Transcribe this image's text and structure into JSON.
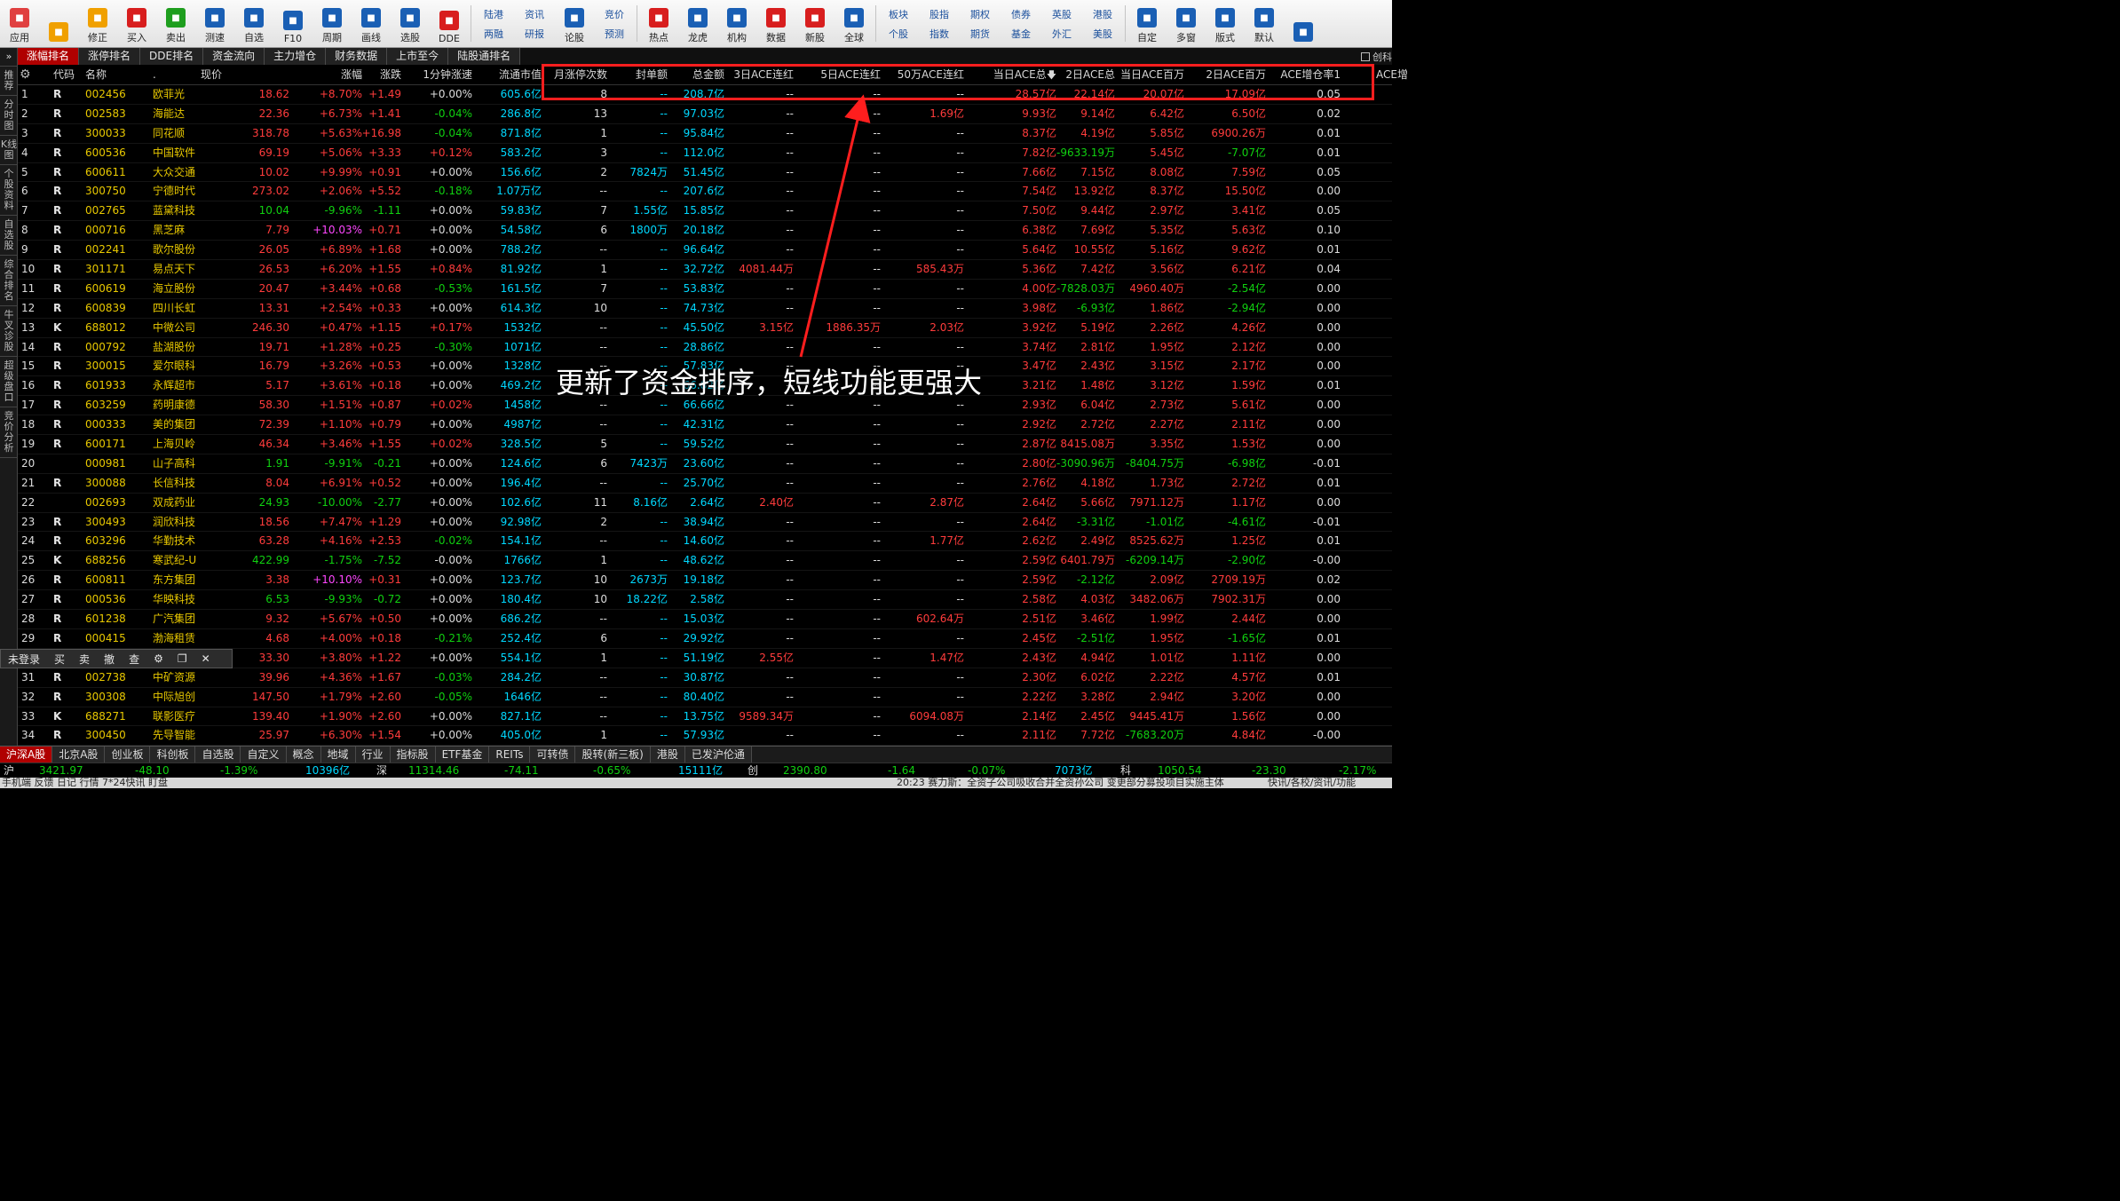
{
  "toolbar": {
    "buttons": [
      {
        "label": "应用",
        "icon": "apps-icon",
        "color": "#e04040"
      },
      {
        "label": "",
        "icon": "back-arrow-icon",
        "color": "#f0a000"
      },
      {
        "label": "修正",
        "icon": "fix-icon",
        "color": "#f0a000"
      },
      {
        "label": "买入",
        "icon": "buy-icon",
        "color": "#d81e1e"
      },
      {
        "label": "卖出",
        "icon": "sell-icon",
        "color": "#1e9e1e"
      },
      {
        "label": "测速",
        "icon": "speed-icon",
        "color": "#1a5fb4"
      },
      {
        "label": "自选",
        "icon": "watchlist-icon",
        "color": "#1a5fb4"
      },
      {
        "label": "F10",
        "icon": "f10-icon",
        "color": "#1a5fb4"
      },
      {
        "label": "周期",
        "icon": "cycle-icon",
        "color": "#1a5fb4"
      },
      {
        "label": "画线",
        "icon": "draw-icon",
        "color": "#1a5fb4"
      },
      {
        "label": "选股",
        "icon": "pick-stock-icon",
        "color": "#1a5fb4"
      },
      {
        "label": "DDE",
        "icon": "dde-icon",
        "color": "#d81e1e"
      }
    ],
    "dual1": [
      {
        "top": "陆港",
        "bottom": "两融"
      },
      {
        "top": "资讯",
        "bottom": "研报"
      }
    ],
    "buttons2": [
      {
        "label": "论股",
        "icon": "forum-icon",
        "color": "#1a5fb4"
      }
    ],
    "dual2": [
      {
        "top": "竞价",
        "bottom": "预测"
      }
    ],
    "buttons3": [
      {
        "label": "热点",
        "icon": "hotspot-icon",
        "color": "#d81e1e"
      },
      {
        "label": "龙虎",
        "icon": "dragon-tiger-icon",
        "color": "#1a5fb4"
      },
      {
        "label": "机构",
        "icon": "institution-icon",
        "color": "#1a5fb4"
      },
      {
        "label": "数据",
        "icon": "data-icon",
        "color": "#d81e1e"
      },
      {
        "label": "新股",
        "icon": "ipo-icon",
        "color": "#d81e1e"
      },
      {
        "label": "全球",
        "icon": "globe-icon",
        "color": "#1a5fb4"
      }
    ],
    "dual3": [
      {
        "top": "板块",
        "bottom": "个股"
      },
      {
        "top": "股指",
        "bottom": "指数"
      },
      {
        "top": "期权",
        "bottom": "期货"
      },
      {
        "top": "债券",
        "bottom": "基金"
      },
      {
        "top": "英股",
        "bottom": "外汇"
      },
      {
        "top": "港股",
        "bottom": "美股"
      }
    ],
    "buttons4": [
      {
        "label": "自定",
        "icon": "custom-icon",
        "color": "#1a5fb4"
      },
      {
        "label": "多窗",
        "icon": "multi-window-icon",
        "color": "#1a5fb4"
      },
      {
        "label": "版式",
        "icon": "layout-icon",
        "color": "#1a5fb4"
      },
      {
        "label": "默认",
        "icon": "home-icon",
        "color": "#1a5fb4"
      },
      {
        "label": "",
        "icon": "house-icon",
        "color": "#1a5fb4"
      }
    ]
  },
  "top_tabs": [
    "涨幅排名",
    "涨停排名",
    "DDE排名",
    "资金流向",
    "主力增仓",
    "财务数据",
    "上市至今",
    "陆股通排名"
  ],
  "active_top_tab": 0,
  "checkbox_label": "创科",
  "left_bar": [
    "推荐",
    "分时图",
    "K线图",
    "个股资料",
    "自选股",
    "综合排名",
    "牛叉诊股",
    "超级盘口",
    "竞价分析"
  ],
  "columns": [
    "",
    "代码",
    "名称",
    ".",
    "现价",
    "涨幅",
    "涨跌",
    "1分钟涨速",
    "流通市值",
    "月涨停次数",
    "封单额",
    "总金额",
    "3日ACE连红",
    "5日ACE连红",
    "50万ACE连红",
    "当日ACE总",
    "2日ACE总",
    "当日ACE百万",
    "2日ACE百万",
    "ACE增仓率1",
    "ACE增"
  ],
  "rows": [
    [
      "1",
      "R",
      "002456",
      "欧菲光",
      "18.62",
      "+8.70%",
      "+1.49",
      "+0.00%",
      "605.6亿",
      "8",
      "--",
      "208.7亿",
      "--",
      "--",
      "--",
      "28.57亿",
      "22.14亿",
      "20.07亿",
      "17.09亿",
      "0.05"
    ],
    [
      "2",
      "R",
      "002583",
      "海能达",
      "22.36",
      "+6.73%",
      "+1.41",
      "-0.04%",
      "286.8亿",
      "13",
      "--",
      "97.03亿",
      "--",
      "--",
      "1.69亿",
      "9.93亿",
      "9.14亿",
      "6.42亿",
      "6.50亿",
      "0.02"
    ],
    [
      "3",
      "R",
      "300033",
      "同花顺",
      "318.78",
      "+5.63%",
      "+16.98",
      "-0.04%",
      "871.8亿",
      "1",
      "--",
      "95.84亿",
      "--",
      "--",
      "--",
      "8.37亿",
      "4.19亿",
      "5.85亿",
      "6900.26万",
      "0.01"
    ],
    [
      "4",
      "R",
      "600536",
      "中国软件",
      "69.19",
      "+5.06%",
      "+3.33",
      "+0.12%",
      "583.2亿",
      "3",
      "--",
      "112.0亿",
      "--",
      "--",
      "--",
      "7.82亿",
      "-9633.19万",
      "5.45亿",
      "-7.07亿",
      "0.01"
    ],
    [
      "5",
      "R",
      "600611",
      "大众交通",
      "10.02",
      "+9.99%",
      "+0.91",
      "+0.00%",
      "156.6亿",
      "2",
      "7824万",
      "51.45亿",
      "--",
      "--",
      "--",
      "7.66亿",
      "7.15亿",
      "8.08亿",
      "7.59亿",
      "0.05"
    ],
    [
      "6",
      "R",
      "300750",
      "宁德时代",
      "273.02",
      "+2.06%",
      "+5.52",
      "-0.18%",
      "1.07万亿",
      "--",
      "--",
      "207.6亿",
      "--",
      "--",
      "--",
      "7.54亿",
      "13.92亿",
      "8.37亿",
      "15.50亿",
      "0.00"
    ],
    [
      "7",
      "R",
      "002765",
      "蓝黛科技",
      "10.04",
      "-9.96%",
      "-1.11",
      "+0.00%",
      "59.83亿",
      "7",
      "1.55亿",
      "15.85亿",
      "--",
      "--",
      "--",
      "7.50亿",
      "9.44亿",
      "2.97亿",
      "3.41亿",
      "0.05"
    ],
    [
      "8",
      "R",
      "000716",
      "黑芝麻",
      "7.79",
      "+10.03%",
      "+0.71",
      "+0.00%",
      "54.58亿",
      "6",
      "1800万",
      "20.18亿",
      "--",
      "--",
      "--",
      "6.38亿",
      "7.69亿",
      "5.35亿",
      "5.63亿",
      "0.10"
    ],
    [
      "9",
      "R",
      "002241",
      "歌尔股份",
      "26.05",
      "+6.89%",
      "+1.68",
      "+0.00%",
      "788.2亿",
      "--",
      "--",
      "96.64亿",
      "--",
      "--",
      "--",
      "5.64亿",
      "10.55亿",
      "5.16亿",
      "9.62亿",
      "0.01"
    ],
    [
      "10",
      "R",
      "301171",
      "易点天下",
      "26.53",
      "+6.20%",
      "+1.55",
      "+0.84%",
      "81.92亿",
      "1",
      "--",
      "32.72亿",
      "4081.44万",
      "--",
      "585.43万",
      "5.36亿",
      "7.42亿",
      "3.56亿",
      "6.21亿",
      "0.04"
    ],
    [
      "11",
      "R",
      "600619",
      "海立股份",
      "20.47",
      "+3.44%",
      "+0.68",
      "-0.53%",
      "161.5亿",
      "7",
      "--",
      "53.83亿",
      "--",
      "--",
      "--",
      "4.00亿",
      "-7828.03万",
      "4960.40万",
      "-2.54亿",
      "0.00"
    ],
    [
      "12",
      "R",
      "600839",
      "四川长虹",
      "13.31",
      "+2.54%",
      "+0.33",
      "+0.00%",
      "614.3亿",
      "10",
      "--",
      "74.73亿",
      "--",
      "--",
      "--",
      "3.98亿",
      "-6.93亿",
      "1.86亿",
      "-2.94亿",
      "0.00"
    ],
    [
      "13",
      "K",
      "688012",
      "中微公司",
      "246.30",
      "+0.47%",
      "+1.15",
      "+0.17%",
      "1532亿",
      "--",
      "--",
      "45.50亿",
      "3.15亿",
      "1886.35万",
      "2.03亿",
      "3.92亿",
      "5.19亿",
      "2.26亿",
      "4.26亿",
      "0.00"
    ],
    [
      "14",
      "R",
      "000792",
      "盐湖股份",
      "19.71",
      "+1.28%",
      "+0.25",
      "-0.30%",
      "1071亿",
      "--",
      "--",
      "28.86亿",
      "--",
      "--",
      "--",
      "3.74亿",
      "2.81亿",
      "1.95亿",
      "2.12亿",
      "0.00"
    ],
    [
      "15",
      "R",
      "300015",
      "爱尔眼科",
      "16.79",
      "+3.26%",
      "+0.53",
      "+0.00%",
      "1328亿",
      "--",
      "--",
      "57.83亿",
      "--",
      "--",
      "--",
      "3.47亿",
      "2.43亿",
      "3.15亿",
      "2.17亿",
      "0.00"
    ],
    [
      "16",
      "R",
      "601933",
      "永辉超市",
      "5.17",
      "+3.61%",
      "+0.18",
      "+0.00%",
      "469.2亿",
      "--",
      "--",
      "66.82亿",
      "--",
      "--",
      "--",
      "3.21亿",
      "1.48亿",
      "3.12亿",
      "1.59亿",
      "0.01"
    ],
    [
      "17",
      "R",
      "603259",
      "药明康德",
      "58.30",
      "+1.51%",
      "+0.87",
      "+0.02%",
      "1458亿",
      "--",
      "--",
      "66.66亿",
      "--",
      "--",
      "--",
      "2.93亿",
      "6.04亿",
      "2.73亿",
      "5.61亿",
      "0.00"
    ],
    [
      "18",
      "R",
      "000333",
      "美的集团",
      "72.39",
      "+1.10%",
      "+0.79",
      "+0.00%",
      "4987亿",
      "--",
      "--",
      "42.31亿",
      "--",
      "--",
      "--",
      "2.92亿",
      "2.72亿",
      "2.27亿",
      "2.11亿",
      "0.00"
    ],
    [
      "19",
      "R",
      "600171",
      "上海贝岭",
      "46.34",
      "+3.46%",
      "+1.55",
      "+0.02%",
      "328.5亿",
      "5",
      "--",
      "59.52亿",
      "--",
      "--",
      "--",
      "2.87亿",
      "8415.08万",
      "3.35亿",
      "1.53亿",
      "0.00"
    ],
    [
      "20",
      "",
      "000981",
      "山子高科",
      "1.91",
      "-9.91%",
      "-0.21",
      "+0.00%",
      "124.6亿",
      "6",
      "7423万",
      "23.60亿",
      "--",
      "--",
      "--",
      "2.80亿",
      "-3090.96万",
      "-8404.75万",
      "-6.98亿",
      "-0.01"
    ],
    [
      "21",
      "R",
      "300088",
      "长信科技",
      "8.04",
      "+6.91%",
      "+0.52",
      "+0.00%",
      "196.4亿",
      "--",
      "--",
      "25.70亿",
      "--",
      "--",
      "--",
      "2.76亿",
      "4.18亿",
      "1.73亿",
      "2.72亿",
      "0.01"
    ],
    [
      "22",
      "",
      "002693",
      "双成药业",
      "24.93",
      "-10.00%",
      "-2.77",
      "+0.00%",
      "102.6亿",
      "11",
      "8.16亿",
      "2.64亿",
      "2.40亿",
      "--",
      "2.87亿",
      "2.64亿",
      "5.66亿",
      "7971.12万",
      "1.17亿",
      "0.00"
    ],
    [
      "23",
      "R",
      "300493",
      "润欣科技",
      "18.56",
      "+7.47%",
      "+1.29",
      "+0.00%",
      "92.98亿",
      "2",
      "--",
      "38.94亿",
      "--",
      "--",
      "--",
      "2.64亿",
      "-3.31亿",
      "-1.01亿",
      "-4.61亿",
      "-0.01"
    ],
    [
      "24",
      "R",
      "603296",
      "华勤技术",
      "63.28",
      "+4.16%",
      "+2.53",
      "-0.02%",
      "154.1亿",
      "--",
      "--",
      "14.60亿",
      "--",
      "--",
      "1.77亿",
      "2.62亿",
      "2.49亿",
      "8525.62万",
      "1.25亿",
      "0.01"
    ],
    [
      "25",
      "K",
      "688256",
      "寒武纪-U",
      "422.99",
      "-1.75%",
      "-7.52",
      "-0.00%",
      "1766亿",
      "1",
      "--",
      "48.62亿",
      "--",
      "--",
      "--",
      "2.59亿",
      "6401.79万",
      "-6209.14万",
      "-2.90亿",
      "-0.00"
    ],
    [
      "26",
      "R",
      "600811",
      "东方集团",
      "3.38",
      "+10.10%",
      "+0.31",
      "+0.00%",
      "123.7亿",
      "10",
      "2673万",
      "19.18亿",
      "--",
      "--",
      "--",
      "2.59亿",
      "-2.12亿",
      "2.09亿",
      "2709.19万",
      "0.02"
    ],
    [
      "27",
      "R",
      "000536",
      "华映科技",
      "6.53",
      "-9.93%",
      "-0.72",
      "+0.00%",
      "180.4亿",
      "10",
      "18.22亿",
      "2.58亿",
      "--",
      "--",
      "--",
      "2.58亿",
      "4.03亿",
      "3482.06万",
      "7902.31万",
      "0.00"
    ],
    [
      "28",
      "R",
      "601238",
      "广汽集团",
      "9.32",
      "+5.67%",
      "+0.50",
      "+0.00%",
      "686.2亿",
      "--",
      "--",
      "15.03亿",
      "--",
      "--",
      "602.64万",
      "2.51亿",
      "3.46亿",
      "1.99亿",
      "2.44亿",
      "0.00"
    ],
    [
      "29",
      "R",
      "000415",
      "渤海租赁",
      "4.68",
      "+4.00%",
      "+0.18",
      "-0.21%",
      "252.4亿",
      "6",
      "--",
      "29.92亿",
      "--",
      "--",
      "--",
      "2.45亿",
      "-2.51亿",
      "1.95亿",
      "-1.65亿",
      "0.01"
    ],
    [
      "30",
      "",
      "",
      "",
      "33.30",
      "+3.80%",
      "+1.22",
      "+0.00%",
      "554.1亿",
      "1",
      "--",
      "51.19亿",
      "2.55亿",
      "--",
      "1.47亿",
      "2.43亿",
      "4.94亿",
      "1.01亿",
      "1.11亿",
      "0.00"
    ],
    [
      "31",
      "R",
      "002738",
      "中矿资源",
      "39.96",
      "+4.36%",
      "+1.67",
      "-0.03%",
      "284.2亿",
      "--",
      "--",
      "30.87亿",
      "--",
      "--",
      "--",
      "2.30亿",
      "6.02亿",
      "2.22亿",
      "4.57亿",
      "0.01"
    ],
    [
      "32",
      "R",
      "300308",
      "中际旭创",
      "147.50",
      "+1.79%",
      "+2.60",
      "-0.05%",
      "1646亿",
      "--",
      "--",
      "80.40亿",
      "--",
      "--",
      "--",
      "2.22亿",
      "3.28亿",
      "2.94亿",
      "3.20亿",
      "0.00"
    ],
    [
      "33",
      "K",
      "688271",
      "联影医疗",
      "139.40",
      "+1.90%",
      "+2.60",
      "+0.00%",
      "827.1亿",
      "--",
      "--",
      "13.75亿",
      "9589.34万",
      "--",
      "6094.08万",
      "2.14亿",
      "2.45亿",
      "9445.41万",
      "1.56亿",
      "0.00"
    ],
    [
      "34",
      "R",
      "300450",
      "先导智能",
      "25.97",
      "+6.30%",
      "+1.54",
      "+0.00%",
      "405.0亿",
      "1",
      "--",
      "57.93亿",
      "--",
      "--",
      "--",
      "2.11亿",
      "7.72亿",
      "-7683.20万",
      "4.84亿",
      "-0.00"
    ]
  ],
  "annotation": {
    "text": "更新了资金排序，短线功能更强大",
    "color": "#ff1e1e"
  },
  "trade_panel": [
    "未登录",
    "买",
    "卖",
    "撤",
    "查",
    "⚙",
    "❐",
    "✕"
  ],
  "bottom_tabs": [
    "沪深A股",
    "北京A股",
    "创业板",
    "科创板",
    "自选股",
    "自定义",
    "概念",
    "地域",
    "行业",
    "指标股",
    "ETF基金",
    "REITs",
    "可转债",
    "股转(新三板)",
    "港股",
    "已发沪伦通"
  ],
  "active_bottom_tab": 0,
  "index_bar": {
    "sh": {
      "label": "沪",
      "value": "3421.97",
      "change": "-48.10",
      "pct": "-1.39%",
      "amount": "10396亿"
    },
    "sz": {
      "label": "深",
      "value": "11314.46",
      "change": "-74.11",
      "pct": "-0.65%",
      "amount": "15111亿"
    },
    "cy": {
      "label": "创",
      "value": "2390.80",
      "change": "-1.64",
      "pct": "-0.07%",
      "amount": "7073亿"
    },
    "kc": {
      "label": "科",
      "value": "1050.54",
      "change": "-23.30",
      "pct": "-2.17%"
    }
  },
  "status": {
    "left": "手机端 反馈 日记 行情 7*24快讯 盯盘",
    "news": "20:23 赛力斯：全资子公司吸收合并全资孙公司 变更部分募投项目实施主体",
    "right": "快讯/各校/资讯/功能"
  }
}
